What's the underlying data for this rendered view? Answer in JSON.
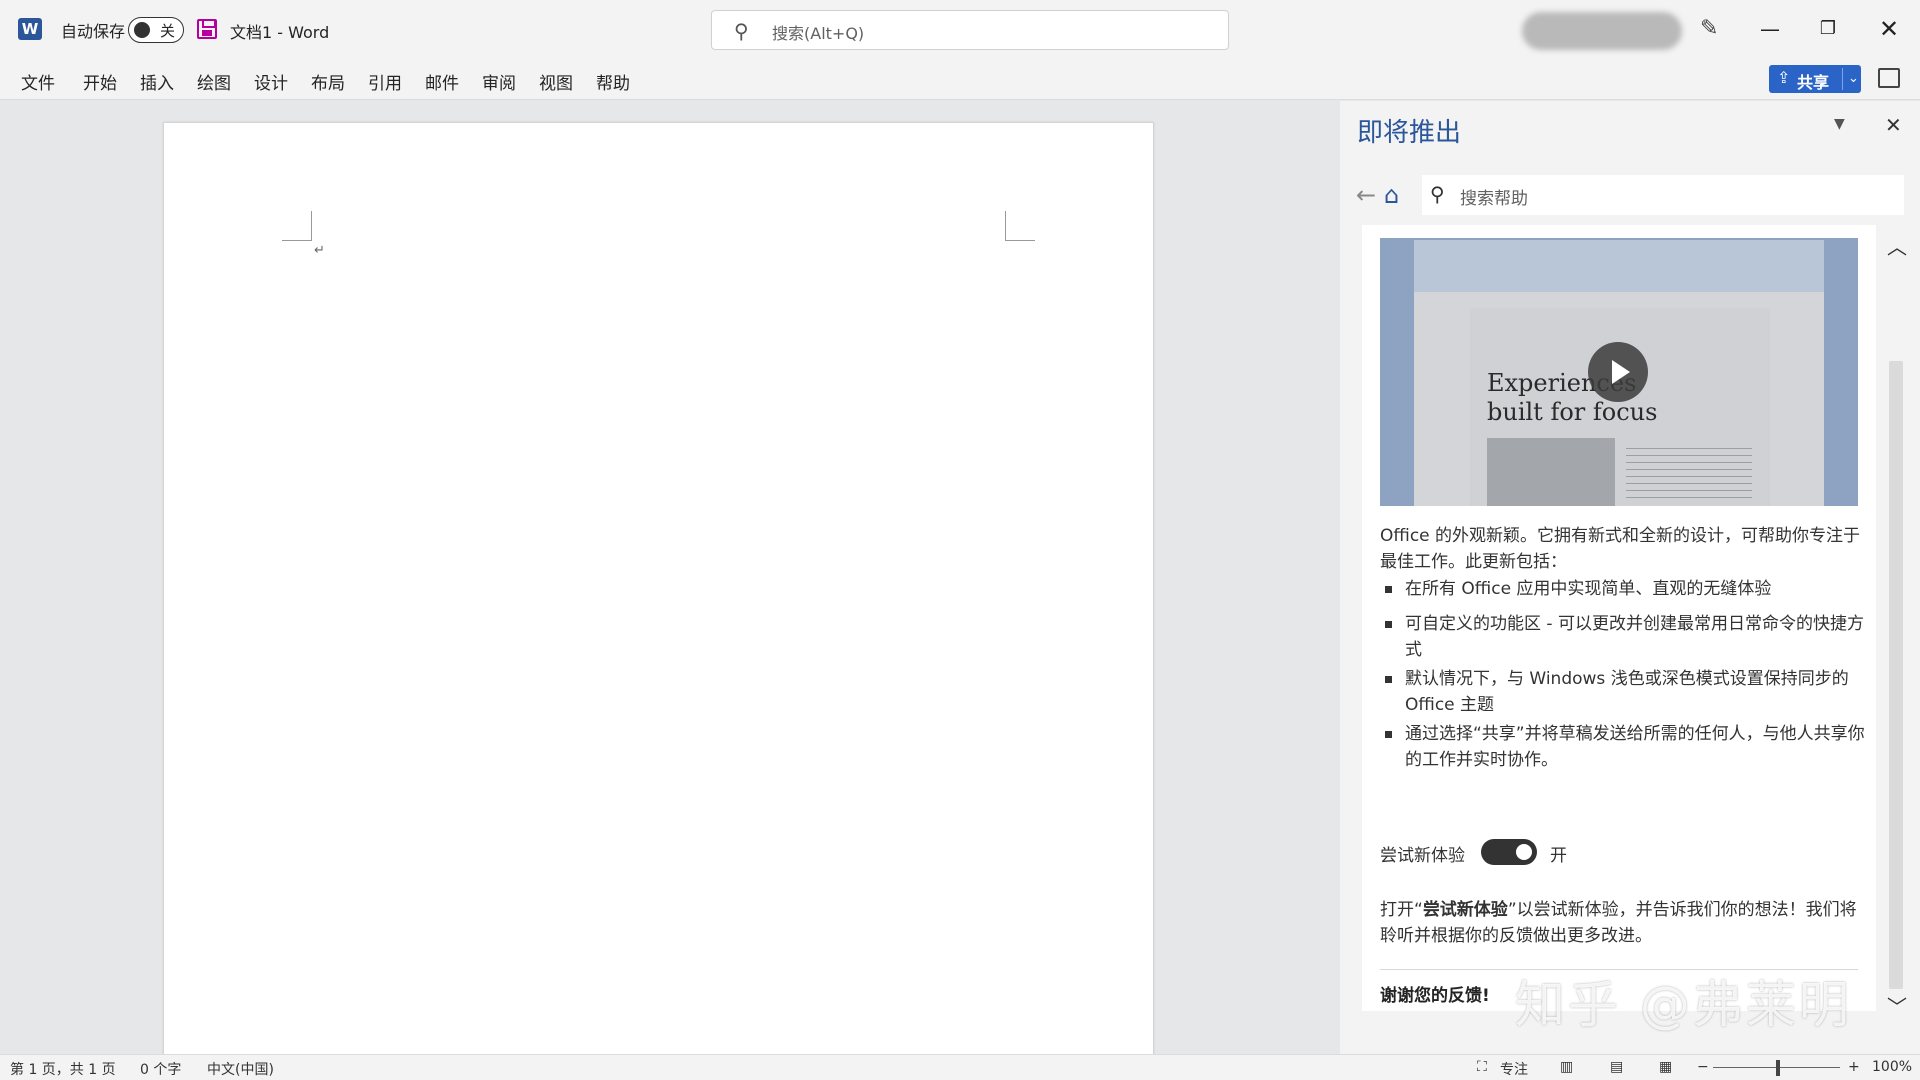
{
  "titlebar": {
    "app_logo": "W",
    "autosave_label": "自动保存",
    "autosave_state": "关",
    "document_title": "文档1  -  Word",
    "search_placeholder": "搜索(Alt+Q)",
    "window_controls": [
      "minimize-icon",
      "restore-icon",
      "close-icon"
    ]
  },
  "menu": {
    "items": [
      "文件",
      "开始",
      "插入",
      "绘图",
      "设计",
      "布局",
      "引用",
      "邮件",
      "审阅",
      "视图",
      "帮助"
    ],
    "share_label": "共享"
  },
  "document": {
    "paragraph_mark": "↵"
  },
  "pane": {
    "title": "即将推出",
    "search_placeholder": "搜索帮助",
    "video": {
      "headline_line1": "Experiences",
      "headline_line2": "built for focus"
    },
    "intro": "Office 的外观新颖。它拥有新式和全新的设计，可帮助你专注于最佳工作。此更新包括：",
    "bullets": [
      "在所有 Office 应用中实现简单、直观的无缝体验",
      "可自定义的功能区 - 可以更改并创建最常用日常命令的快捷方式",
      "默认情况下，与 Windows 浅色或深色模式设置保持同步的 Office 主题",
      "通过选择“共享”并将草稿发送给所需的任何人，与他人共享你的工作并实时协作。"
    ],
    "try_label": "尝试新体验",
    "try_state": "开",
    "outro_prefix": "打开“",
    "outro_bold": "尝试新体验",
    "outro_suffix": "”以尝试新体验，并告诉我们你的想法！我们将聆听并根据你的反馈做出更多改进。",
    "thanks": "谢谢您的反馈!"
  },
  "watermark": "知乎 @弗莱明",
  "statusbar": {
    "page_info": "第 1 页，共 1 页",
    "word_count": "0 个字",
    "language": "中文(中国)",
    "focus_label": "专注",
    "zoom_level": "100%"
  },
  "colors": {
    "accent": "#2b579a",
    "share_button": "#2b64c7",
    "save_icon": "#b4009e"
  }
}
